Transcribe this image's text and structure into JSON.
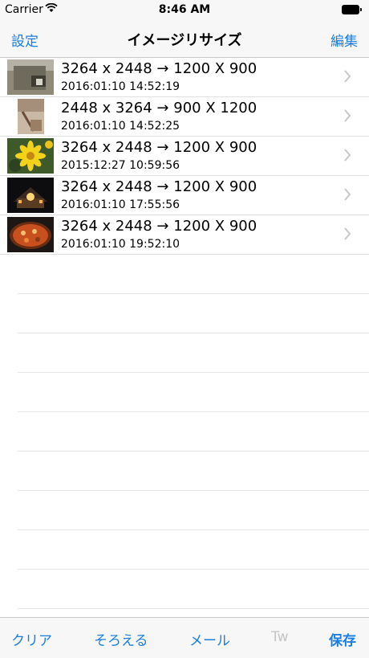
{
  "status_bar": {
    "carrier": "Carrier",
    "time": "8:46 AM"
  },
  "nav": {
    "left": "設定",
    "title": "イメージリサイズ",
    "right": "編集"
  },
  "rows": [
    {
      "title": "3264 x 2448 → 1200 X 900",
      "subtitle": "2016:01:10 14:52:19"
    },
    {
      "title": "2448 x 3264 → 900 X 1200",
      "subtitle": "2016:01:10 14:52:25"
    },
    {
      "title": "3264 x 2448 → 1200 X 900",
      "subtitle": "2015:12:27 10:59:56"
    },
    {
      "title": "3264 x 2448 → 1200 X 900",
      "subtitle": "2016:01:10 17:55:56"
    },
    {
      "title": "3264 x 2448 → 1200 X 900",
      "subtitle": "2016:01:10 19:52:10"
    }
  ],
  "toolbar": {
    "clear": "クリア",
    "align": "そろえる",
    "mail": "メール",
    "tw": "Tw",
    "save": "保存"
  },
  "colors": {
    "accent": "#1a7ee0",
    "disabled": "#c4c4c4"
  }
}
